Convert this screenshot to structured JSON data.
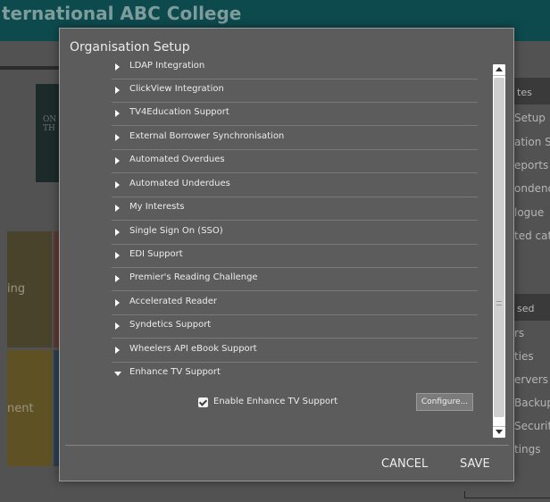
{
  "background": {
    "college_title": "ternational ABC College",
    "book_text": "ON\nTH",
    "tiles": [
      "ing",
      "nent"
    ],
    "right_panel_1": {
      "header": "tes",
      "items": [
        "Setup",
        "ation S",
        "eports",
        "ondenc",
        "logue",
        "ted cata"
      ]
    },
    "right_panel_2": {
      "header": "sed",
      "items": [
        "rs",
        "ties",
        "ervers",
        "Backup",
        "Securit",
        "tings"
      ]
    }
  },
  "modal": {
    "title": "Organisation Setup",
    "sections": [
      {
        "label": "LDAP Integration",
        "expanded": false
      },
      {
        "label": "ClickView Integration",
        "expanded": false
      },
      {
        "label": "TV4Education Support",
        "expanded": false
      },
      {
        "label": "External Borrower Synchronisation",
        "expanded": false
      },
      {
        "label": "Automated Overdues",
        "expanded": false
      },
      {
        "label": "Automated Underdues",
        "expanded": false
      },
      {
        "label": "My Interests",
        "expanded": false
      },
      {
        "label": "Single Sign On (SSO)",
        "expanded": false
      },
      {
        "label": "EDI Support",
        "expanded": false
      },
      {
        "label": "Premier's Reading Challenge",
        "expanded": false
      },
      {
        "label": "Accelerated Reader",
        "expanded": false
      },
      {
        "label": "Syndetics Support",
        "expanded": false
      },
      {
        "label": "Wheelers API eBook Support",
        "expanded": false
      },
      {
        "label": "Enhance TV Support",
        "expanded": true
      }
    ],
    "enhance_tv": {
      "checkbox_label": "Enable Enhance TV Support",
      "checked": true,
      "configure_label": "Configure..."
    },
    "cancel_label": "CANCEL",
    "save_label": "SAVE"
  }
}
